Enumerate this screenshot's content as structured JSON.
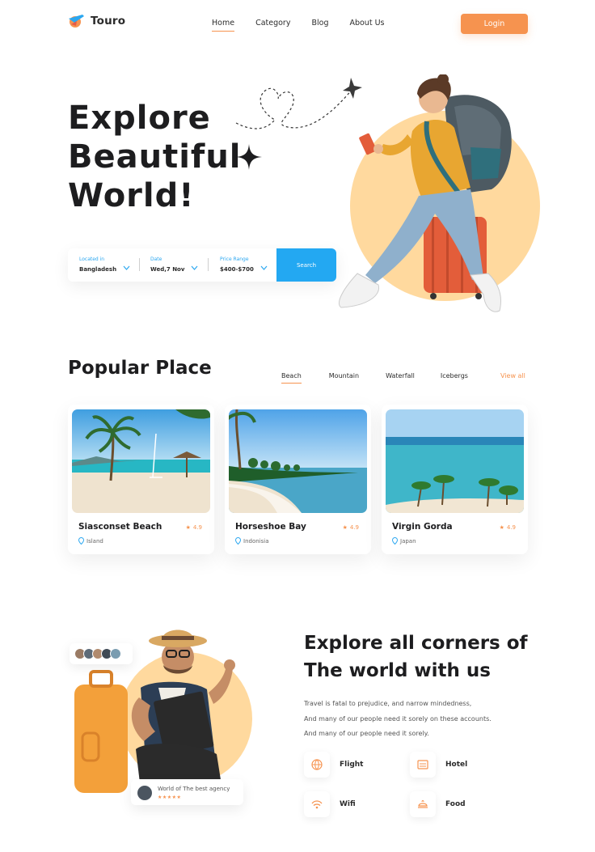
{
  "brand": {
    "name": "Touro",
    "accent": "#f6934f",
    "blue": "#23a8f2",
    "peach": "#ffd99e"
  },
  "nav": {
    "items": [
      {
        "label": "Home",
        "active": true
      },
      {
        "label": "Category",
        "active": false
      },
      {
        "label": "Blog",
        "active": false
      },
      {
        "label": "About Us",
        "active": false
      }
    ],
    "login_label": "Login"
  },
  "hero": {
    "title_lines": [
      "Explore",
      "Beautiful",
      "World!"
    ],
    "search": {
      "location_label": "Located in",
      "location_value": "Bangladesh",
      "date_label": "Date",
      "date_value": "Wed,7 Nov",
      "price_label": "Price Range",
      "price_value": "$400-$700",
      "button_label": "Search"
    }
  },
  "popular": {
    "title": "Popular Place",
    "filters": [
      "Beach",
      "Mountain",
      "Waterfall",
      "Icebergs"
    ],
    "active_filter": "Beach",
    "view_all": "View all",
    "cards": [
      {
        "name": "Siasconset Beach",
        "rating": "4.9",
        "location": "Island"
      },
      {
        "name": "Horseshoe Bay",
        "rating": "4.9",
        "location": "Indonisia"
      },
      {
        "name": "Virgin Gorda",
        "rating": "4.9",
        "location": "Japan"
      }
    ]
  },
  "explore": {
    "title_line1": "Explore all corners of",
    "title_line2": "The world with us",
    "text_lines": [
      "Travel is  fatal to prejudice, and narrow mindedness,",
      "And many of our people need it sorely on these accounts.",
      "And many of our people need it sorely."
    ],
    "agency_text": "World of The best agency",
    "agency_stars": "★★★★★",
    "features": [
      {
        "label": "Flight",
        "icon": "globe-plane-icon"
      },
      {
        "label": "Hotel",
        "icon": "hotel-icon"
      },
      {
        "label": "Wifi",
        "icon": "wifi-icon"
      },
      {
        "label": "Food",
        "icon": "food-icon"
      }
    ]
  }
}
